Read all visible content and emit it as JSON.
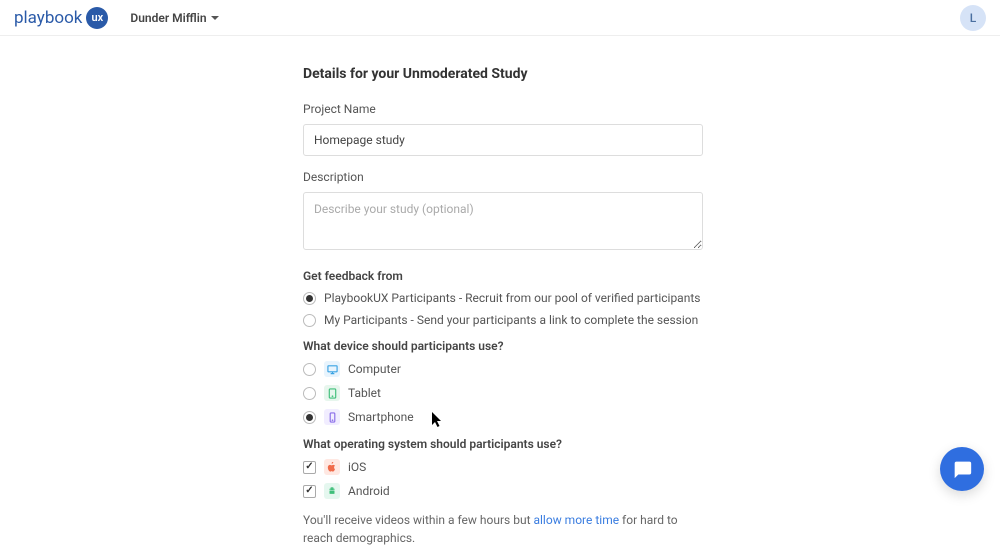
{
  "header": {
    "logo_text": "playbook",
    "logo_badge": "ux",
    "workspace_name": "Dunder Mifflin",
    "avatar_initial": "L"
  },
  "page": {
    "title": "Details for your Unmoderated Study",
    "project_name_label": "Project Name",
    "project_name_value": "Homepage study",
    "description_label": "Description",
    "description_placeholder": "Describe your study (optional)",
    "description_value": ""
  },
  "feedback_source": {
    "title": "Get feedback from",
    "options": [
      {
        "label": "PlaybookUX Participants - Recruit from our pool of verified participants",
        "selected": true
      },
      {
        "label": "My Participants - Send your participants a link to complete the session",
        "selected": false
      }
    ]
  },
  "device": {
    "title": "What device should participants use?",
    "options": [
      {
        "label": "Computer",
        "icon": "computer-icon",
        "color": "#3aa3e3",
        "selected": false
      },
      {
        "label": "Tablet",
        "icon": "tablet-icon",
        "color": "#3fbf7a",
        "selected": false
      },
      {
        "label": "Smartphone",
        "icon": "smartphone-icon",
        "color": "#8a6de8",
        "selected": true
      }
    ]
  },
  "os": {
    "title": "What operating system should participants use?",
    "options": [
      {
        "label": "iOS",
        "icon": "apple-icon",
        "color": "#f06b4a",
        "checked": true
      },
      {
        "label": "Android",
        "icon": "android-icon",
        "color": "#3fbf7a",
        "checked": true
      }
    ]
  },
  "footnote": {
    "pre": "You'll receive videos within a few hours but ",
    "link": "allow more time",
    "post": " for hard to reach demographics."
  }
}
